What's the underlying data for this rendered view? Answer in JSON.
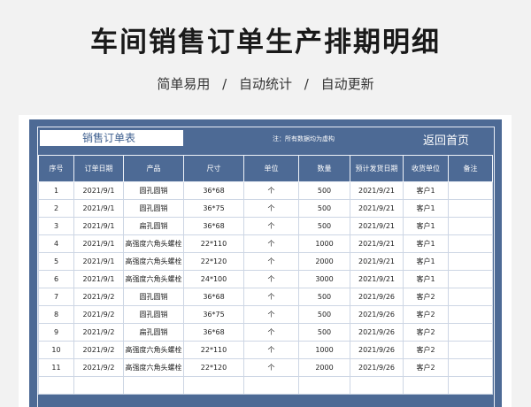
{
  "header": {
    "title": "车间销售订单生产排期明细",
    "tags": [
      "简单易用",
      "自动统计",
      "自动更新"
    ],
    "separator": "/"
  },
  "toolbar": {
    "sheet_tab": "销售订单表",
    "note": "注：所有数据均为虚构",
    "back_label": "返回首页"
  },
  "colors": {
    "panel": "#4d6a95",
    "background": "#f2f2f2"
  },
  "table": {
    "headers": [
      "序号",
      "订单日期",
      "产品",
      "尺寸",
      "单位",
      "数量",
      "预计发货日期",
      "收货单位",
      "备注"
    ],
    "rows": [
      [
        "1",
        "2021/9/1",
        "圆孔圆销",
        "36*68",
        "个",
        "500",
        "2021/9/21",
        "客户1",
        ""
      ],
      [
        "2",
        "2021/9/1",
        "圆孔圆销",
        "36*75",
        "个",
        "500",
        "2021/9/21",
        "客户1",
        ""
      ],
      [
        "3",
        "2021/9/1",
        "扁孔圆销",
        "36*68",
        "个",
        "500",
        "2021/9/21",
        "客户1",
        ""
      ],
      [
        "4",
        "2021/9/1",
        "高强度六角头螺栓",
        "22*110",
        "个",
        "1000",
        "2021/9/21",
        "客户1",
        ""
      ],
      [
        "5",
        "2021/9/1",
        "高强度六角头螺栓",
        "22*120",
        "个",
        "2000",
        "2021/9/21",
        "客户1",
        ""
      ],
      [
        "6",
        "2021/9/1",
        "高强度六角头螺栓",
        "24*100",
        "个",
        "3000",
        "2021/9/21",
        "客户1",
        ""
      ],
      [
        "7",
        "2021/9/2",
        "圆孔圆销",
        "36*68",
        "个",
        "500",
        "2021/9/26",
        "客户2",
        ""
      ],
      [
        "8",
        "2021/9/2",
        "圆孔圆销",
        "36*75",
        "个",
        "500",
        "2021/9/26",
        "客户2",
        ""
      ],
      [
        "9",
        "2021/9/2",
        "扁孔圆销",
        "36*68",
        "个",
        "500",
        "2021/9/26",
        "客户2",
        ""
      ],
      [
        "10",
        "2021/9/2",
        "高强度六角头螺栓",
        "22*110",
        "个",
        "1000",
        "2021/9/26",
        "客户2",
        ""
      ],
      [
        "11",
        "2021/9/2",
        "高强度六角头螺栓",
        "22*120",
        "个",
        "2000",
        "2021/9/26",
        "客户2",
        ""
      ],
      [
        "",
        "",
        "",
        "",
        "",
        "",
        "",
        "",
        ""
      ]
    ]
  }
}
